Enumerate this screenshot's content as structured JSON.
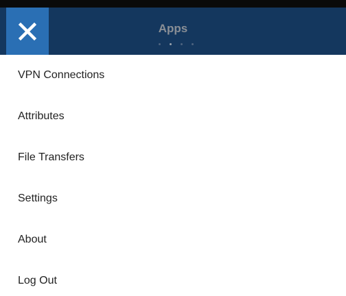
{
  "header": {
    "title": "Apps",
    "close_icon": "close-x-icon",
    "page_dots": {
      "count": 4,
      "active_index": 1
    }
  },
  "menu": {
    "items": [
      {
        "label": "VPN Connections"
      },
      {
        "label": "Attributes"
      },
      {
        "label": "File Transfers"
      },
      {
        "label": "Settings"
      },
      {
        "label": "About"
      },
      {
        "label": "Log Out"
      }
    ]
  },
  "colors": {
    "header_bg": "#14375e",
    "close_bg": "#2a6fb4",
    "title_text": "#8a8f96"
  }
}
